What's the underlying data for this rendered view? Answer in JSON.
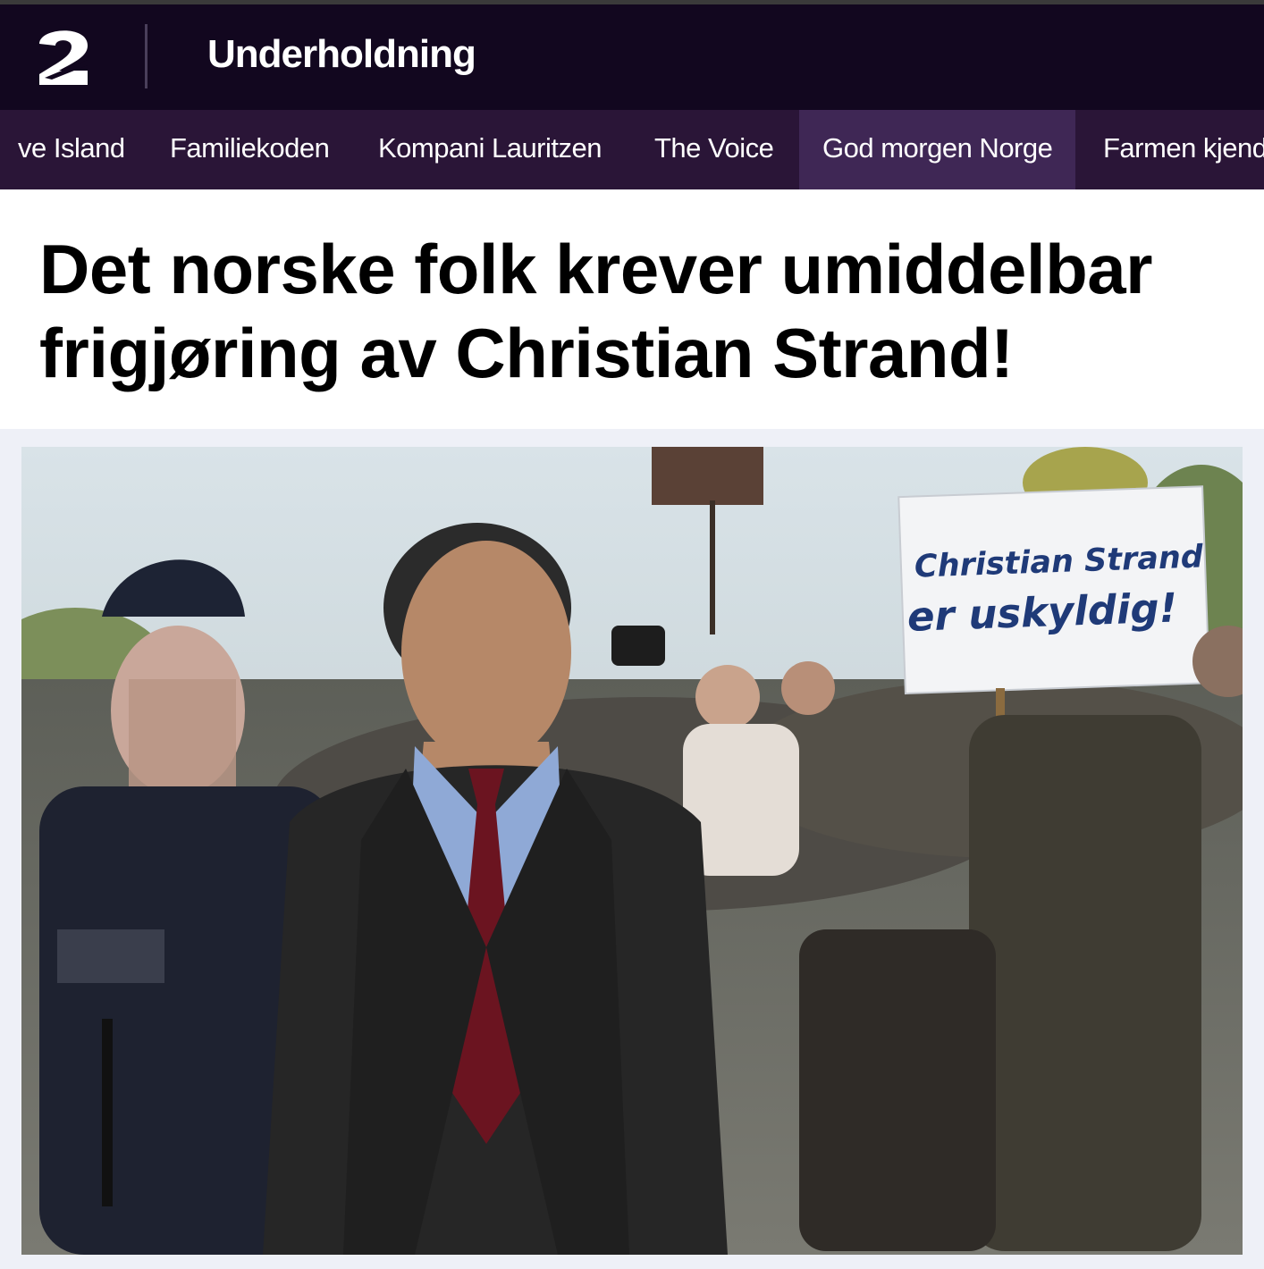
{
  "header": {
    "logo_text": "2",
    "section": "Underholdning"
  },
  "nav": {
    "items": [
      {
        "label": "ve Island",
        "active": false
      },
      {
        "label": "Familiekoden",
        "active": false
      },
      {
        "label": "Kompani Lauritzen",
        "active": false
      },
      {
        "label": "The Voice",
        "active": false
      },
      {
        "label": "God morgen Norge",
        "active": true
      },
      {
        "label": "Farmen kjend",
        "active": false
      }
    ]
  },
  "article": {
    "headline": "Det norske folk krever umiddelbar frigjøring av Christian Strand!"
  },
  "photo": {
    "sign_line1": "Christian Strand",
    "sign_line2": "er uskyldig!"
  },
  "colors": {
    "header_bg": "#12071f",
    "nav_bg": "#2a1537",
    "nav_active_bg": "#3f2755",
    "headline": "#000000"
  }
}
